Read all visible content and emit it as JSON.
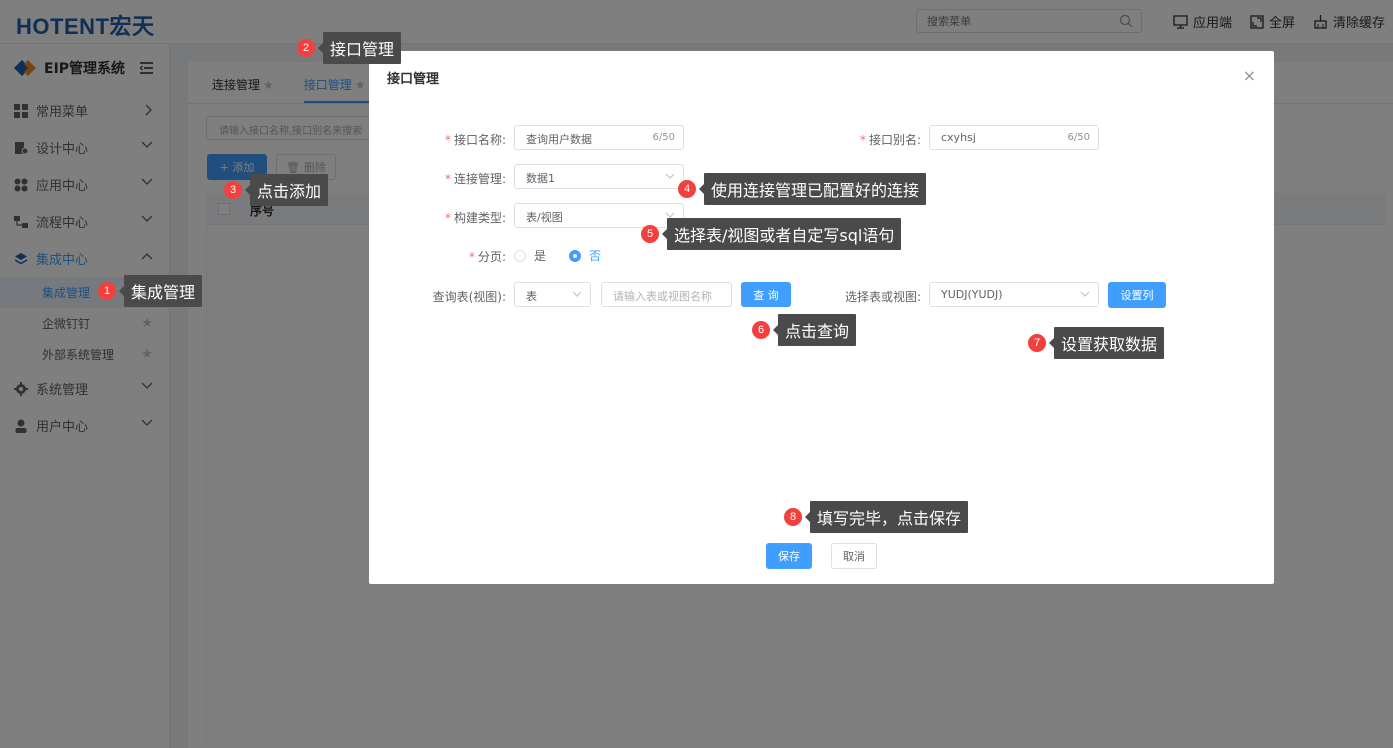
{
  "topbar": {
    "logo": "HOTENT宏天",
    "search_placeholder": "搜索菜单",
    "links": [
      {
        "icon": "monitor-icon",
        "label": "应用端"
      },
      {
        "icon": "fullscreen-icon",
        "label": "全屏"
      },
      {
        "icon": "broom-icon",
        "label": "清除缓存"
      }
    ]
  },
  "sidebar": {
    "title": "EIP管理系统",
    "items": [
      {
        "icon": "grid-icon",
        "label": "常用菜单"
      },
      {
        "icon": "design-icon",
        "label": "设计中心"
      },
      {
        "icon": "apps-icon",
        "label": "应用中心"
      },
      {
        "icon": "flow-icon",
        "label": "流程中心"
      },
      {
        "icon": "layers-icon",
        "label": "集成中心"
      },
      {
        "icon": "gear-icon",
        "label": "系统管理"
      },
      {
        "icon": "user-icon",
        "label": "用户中心"
      }
    ],
    "sub_items": [
      {
        "label": "集成管理"
      },
      {
        "label": "企微钉钉"
      },
      {
        "label": "外部系统管理"
      }
    ]
  },
  "content": {
    "tabs": [
      {
        "label": "连接管理"
      },
      {
        "label": "接口管理"
      }
    ],
    "search_placeholder": "请输入接口名称,接口别名来搜索",
    "add_label": "+ 添加",
    "delete_label": "删除",
    "column_seq": "序号"
  },
  "dialog": {
    "title": "接口管理",
    "close": "×",
    "fields": {
      "name_label": "接口名称:",
      "name_value": "查询用户数据",
      "name_count": "6/50",
      "alias_label": "接口别名:",
      "alias_value": "cxyhsj",
      "alias_count": "6/50",
      "conn_label": "连接管理:",
      "conn_value": "数据1",
      "build_label": "构建类型:",
      "build_value": "表/视图",
      "paging_label": "分页:",
      "paging_yes": "是",
      "paging_no": "否",
      "query_label": "查询表(视图):",
      "query_type": "表",
      "query_placeholder": "请输入表或视图名称",
      "query_button": "查 询",
      "select_label": "选择表或视图:",
      "select_value": "YUDJ(YUDJ)",
      "setcol_button": "设置列"
    },
    "save_button": "保存",
    "cancel_button": "取消"
  },
  "annotations": [
    {
      "num": "1",
      "text": "集成管理"
    },
    {
      "num": "2",
      "text": "接口管理"
    },
    {
      "num": "3",
      "text": "点击添加"
    },
    {
      "num": "4",
      "text": "使用连接管理已配置好的连接"
    },
    {
      "num": "5",
      "text": "选择表/视图或者自定写sql语句"
    },
    {
      "num": "6",
      "text": "点击查询"
    },
    {
      "num": "7",
      "text": "设置获取数据"
    },
    {
      "num": "8",
      "text": "填写完毕，点击保存"
    }
  ],
  "colors": {
    "primary": "#409eff",
    "brand": "#1f5fa8",
    "badge": "#f43f3f",
    "tip_bg": "#4a4a4a"
  }
}
